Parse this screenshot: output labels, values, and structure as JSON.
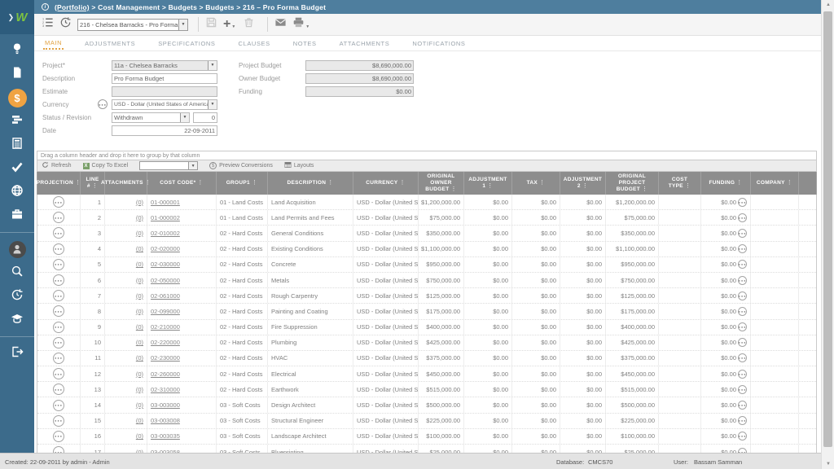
{
  "topbar": {
    "portfolio_link": "(Portfolio)",
    "trail": " > Cost Management > Budgets > Budgets > 216 – Pro Forma Budget",
    "info_glyph": "i"
  },
  "toolbar": {
    "record_selector_value": "216 - Chelsea Barracks - Pro Forma B",
    "icons": [
      "record-list-icon",
      "history-icon",
      "save-icon",
      "add-icon",
      "delete-icon",
      "mail-icon",
      "print-icon"
    ]
  },
  "tabs": {
    "active": "MAIN",
    "items": [
      "MAIN",
      "ADJUSTMENTS",
      "SPECIFICATIONS",
      "CLAUSES",
      "NOTES",
      "ATTACHMENTS",
      "NOTIFICATIONS"
    ]
  },
  "form": {
    "project_label": "Project*",
    "project_value": "11a - Chelsea Barracks",
    "description_label": "Description",
    "description_value": "Pro Forma Budget",
    "estimate_label": "Estimate",
    "estimate_value": "",
    "currency_label": "Currency",
    "currency_value": "USD - Dollar (United States of America)",
    "status_revision_label": "Status / Revision",
    "status_value": "Withdrawn",
    "revision_value": "0",
    "date_label": "Date",
    "date_value": "22-09-2011",
    "project_budget_label": "Project Budget",
    "project_budget_value": "$8,690,000.00",
    "owner_budget_label": "Owner Budget",
    "owner_budget_value": "$8,690,000.00",
    "funding_label": "Funding",
    "funding_value": "$0.00"
  },
  "grid": {
    "group_hint": "Drag a column header and drop it here to group by that column",
    "toolbar": {
      "refresh": "Refresh",
      "copy_to_excel": "Copy To Excel",
      "excel_glyph": "X",
      "filter_value": "",
      "preview_conversions": "Preview Conversions",
      "conversions_glyph": "$",
      "layouts": "Layouts"
    },
    "menu_glyph": "⋮",
    "columns": [
      "PROJECTION",
      "LINE #",
      "ATTACHMENTS",
      "COST CODE*",
      "GROUP1",
      "DESCRIPTION",
      "CURRENCY",
      "ORIGINAL OWNER BUDGET",
      "ADJUSTMENT 1",
      "TAX",
      "ADJUSTMENT 2",
      "ORIGINAL PROJECT BUDGET",
      "COST TYPE",
      "FUNDING",
      "COMPANY"
    ],
    "rows": [
      {
        "line": "1",
        "attachments": "(0)",
        "cost_code": "01-000001",
        "group": "01 - Land Costs",
        "description": "Land Acquisition",
        "currency": "USD - Dollar (United States of America)",
        "owner_budget": "$1,200,000.00",
        "adjustment1": "$0.00",
        "tax": "$0.00",
        "adjustment2": "$0.00",
        "project_budget": "$1,200,000.00",
        "cost_type": "",
        "funding": "$0.00",
        "company": ""
      },
      {
        "line": "2",
        "attachments": "(0)",
        "cost_code": "01-000002",
        "group": "01 - Land Costs",
        "description": "Land Permits and Fees",
        "currency": "USD - Dollar (United States of America)",
        "owner_budget": "$75,000.00",
        "adjustment1": "$0.00",
        "tax": "$0.00",
        "adjustment2": "$0.00",
        "project_budget": "$75,000.00",
        "cost_type": "",
        "funding": "$0.00",
        "company": ""
      },
      {
        "line": "3",
        "attachments": "(0)",
        "cost_code": "02-010002",
        "group": "02 - Hard Costs",
        "description": "General Conditions",
        "currency": "USD - Dollar (United States of America)",
        "owner_budget": "$350,000.00",
        "adjustment1": "$0.00",
        "tax": "$0.00",
        "adjustment2": "$0.00",
        "project_budget": "$350,000.00",
        "cost_type": "",
        "funding": "$0.00",
        "company": ""
      },
      {
        "line": "4",
        "attachments": "(0)",
        "cost_code": "02-020000",
        "group": "02 - Hard Costs",
        "description": "Existing Conditions",
        "currency": "USD - Dollar (United States of America)",
        "owner_budget": "$1,100,000.00",
        "adjustment1": "$0.00",
        "tax": "$0.00",
        "adjustment2": "$0.00",
        "project_budget": "$1,100,000.00",
        "cost_type": "",
        "funding": "$0.00",
        "company": ""
      },
      {
        "line": "5",
        "attachments": "(0)",
        "cost_code": "02-030000",
        "group": "02 - Hard Costs",
        "description": "Concrete",
        "currency": "USD - Dollar (United States of America)",
        "owner_budget": "$950,000.00",
        "adjustment1": "$0.00",
        "tax": "$0.00",
        "adjustment2": "$0.00",
        "project_budget": "$950,000.00",
        "cost_type": "",
        "funding": "$0.00",
        "company": ""
      },
      {
        "line": "6",
        "attachments": "(0)",
        "cost_code": "02-050000",
        "group": "02 - Hard Costs",
        "description": "Metals",
        "currency": "USD - Dollar (United States of America)",
        "owner_budget": "$750,000.00",
        "adjustment1": "$0.00",
        "tax": "$0.00",
        "adjustment2": "$0.00",
        "project_budget": "$750,000.00",
        "cost_type": "",
        "funding": "$0.00",
        "company": ""
      },
      {
        "line": "7",
        "attachments": "(0)",
        "cost_code": "02-061000",
        "group": "02 - Hard Costs",
        "description": "Rough Carpentry",
        "currency": "USD - Dollar (United States of America)",
        "owner_budget": "$125,000.00",
        "adjustment1": "$0.00",
        "tax": "$0.00",
        "adjustment2": "$0.00",
        "project_budget": "$125,000.00",
        "cost_type": "",
        "funding": "$0.00",
        "company": ""
      },
      {
        "line": "8",
        "attachments": "(0)",
        "cost_code": "02-099000",
        "group": "02 - Hard Costs",
        "description": "Painting and Coating",
        "currency": "USD - Dollar (United States of America)",
        "owner_budget": "$175,000.00",
        "adjustment1": "$0.00",
        "tax": "$0.00",
        "adjustment2": "$0.00",
        "project_budget": "$175,000.00",
        "cost_type": "",
        "funding": "$0.00",
        "company": ""
      },
      {
        "line": "9",
        "attachments": "(0)",
        "cost_code": "02-210000",
        "group": "02 - Hard Costs",
        "description": "Fire Suppression",
        "currency": "USD - Dollar (United States of America)",
        "owner_budget": "$400,000.00",
        "adjustment1": "$0.00",
        "tax": "$0.00",
        "adjustment2": "$0.00",
        "project_budget": "$400,000.00",
        "cost_type": "",
        "funding": "$0.00",
        "company": ""
      },
      {
        "line": "10",
        "attachments": "(0)",
        "cost_code": "02-220000",
        "group": "02 - Hard Costs",
        "description": "Plumbing",
        "currency": "USD - Dollar (United States of America)",
        "owner_budget": "$425,000.00",
        "adjustment1": "$0.00",
        "tax": "$0.00",
        "adjustment2": "$0.00",
        "project_budget": "$425,000.00",
        "cost_type": "",
        "funding": "$0.00",
        "company": ""
      },
      {
        "line": "11",
        "attachments": "(0)",
        "cost_code": "02-230000",
        "group": "02 - Hard Costs",
        "description": "HVAC",
        "currency": "USD - Dollar (United States of America)",
        "owner_budget": "$375,000.00",
        "adjustment1": "$0.00",
        "tax": "$0.00",
        "adjustment2": "$0.00",
        "project_budget": "$375,000.00",
        "cost_type": "",
        "funding": "$0.00",
        "company": ""
      },
      {
        "line": "12",
        "attachments": "(0)",
        "cost_code": "02-260000",
        "group": "02 - Hard Costs",
        "description": "Electrical",
        "currency": "USD - Dollar (United States of America)",
        "owner_budget": "$450,000.00",
        "adjustment1": "$0.00",
        "tax": "$0.00",
        "adjustment2": "$0.00",
        "project_budget": "$450,000.00",
        "cost_type": "",
        "funding": "$0.00",
        "company": ""
      },
      {
        "line": "13",
        "attachments": "(0)",
        "cost_code": "02-310000",
        "group": "02 - Hard Costs",
        "description": "Earthwork",
        "currency": "USD - Dollar (United States of America)",
        "owner_budget": "$515,000.00",
        "adjustment1": "$0.00",
        "tax": "$0.00",
        "adjustment2": "$0.00",
        "project_budget": "$515,000.00",
        "cost_type": "",
        "funding": "$0.00",
        "company": ""
      },
      {
        "line": "14",
        "attachments": "(0)",
        "cost_code": "03-003000",
        "group": "03 - Soft Costs",
        "description": "Design Architect",
        "currency": "USD - Dollar (United States of America)",
        "owner_budget": "$500,000.00",
        "adjustment1": "$0.00",
        "tax": "$0.00",
        "adjustment2": "$0.00",
        "project_budget": "$500,000.00",
        "cost_type": "",
        "funding": "$0.00",
        "company": ""
      },
      {
        "line": "15",
        "attachments": "(0)",
        "cost_code": "03-003008",
        "group": "03 - Soft Costs",
        "description": "Structural Engineer",
        "currency": "USD - Dollar (United States of America)",
        "owner_budget": "$225,000.00",
        "adjustment1": "$0.00",
        "tax": "$0.00",
        "adjustment2": "$0.00",
        "project_budget": "$225,000.00",
        "cost_type": "",
        "funding": "$0.00",
        "company": ""
      },
      {
        "line": "16",
        "attachments": "(0)",
        "cost_code": "03-003035",
        "group": "03 - Soft Costs",
        "description": "Landscape Architect",
        "currency": "USD - Dollar (United States of America)",
        "owner_budget": "$100,000.00",
        "adjustment1": "$0.00",
        "tax": "$0.00",
        "adjustment2": "$0.00",
        "project_budget": "$100,000.00",
        "cost_type": "",
        "funding": "$0.00",
        "company": ""
      },
      {
        "line": "17",
        "attachments": "(0)",
        "cost_code": "03-003058",
        "group": "03 - Soft Costs",
        "description": "Blueprinting",
        "currency": "USD - Dollar (United States of America)",
        "owner_budget": "$25,000.00",
        "adjustment1": "$0.00",
        "tax": "$0.00",
        "adjustment2": "$0.00",
        "project_budget": "$25,000.00",
        "cost_type": "",
        "funding": "$0.00",
        "company": ""
      }
    ]
  },
  "sidebar": {
    "items": [
      {
        "icon": "lightbulb-icon"
      },
      {
        "icon": "document-icon"
      },
      {
        "icon": "dollar-icon",
        "active": true,
        "glyph": "$"
      },
      {
        "icon": "layers-icon"
      },
      {
        "icon": "calculator-icon"
      },
      {
        "icon": "checkmark-icon"
      },
      {
        "icon": "globe-icon"
      },
      {
        "icon": "briefcase-icon"
      },
      {
        "icon": "user-avatar-icon",
        "divider_before": true
      },
      {
        "icon": "search-icon"
      },
      {
        "icon": "history-icon"
      },
      {
        "icon": "graduation-cap-icon"
      },
      {
        "icon": "logout-icon",
        "divider_before": true
      }
    ]
  },
  "statusbar": {
    "created": "Created:  22-09-2011 by admin - Admin",
    "database_label": "Database:",
    "database_value": "CMCS70",
    "user_label": "User:",
    "user_value": "Bassam Samman"
  },
  "colors": {
    "topbar": "#4e7e9e",
    "sidebar": "#3c6b8b",
    "accent_orange": "#efa343",
    "logo_green": "#7cc142",
    "grid_header": "#8d8d8d"
  }
}
